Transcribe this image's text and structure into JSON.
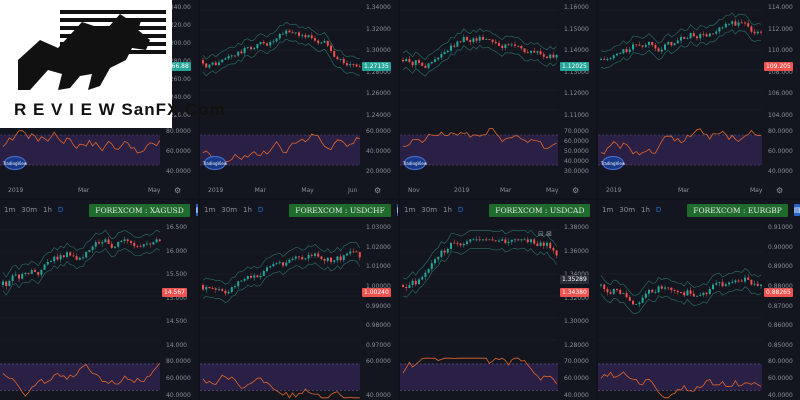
{
  "logo": {
    "text": "R E V I E W SanFX.Com"
  },
  "timeframes": [
    "1m",
    "30m",
    "1h",
    "D"
  ],
  "badge_text": "TradingView",
  "panels": [
    {
      "id": "p1",
      "symbol": "",
      "last": "1366.88",
      "last_color": "#26a69a",
      "yticks": [
        "1340.00",
        "1320.00",
        "1300.00",
        "1280.00",
        "1260.00",
        "1240.00",
        "1220.00"
      ],
      "osc_ticks": [
        "80.0000",
        "60.0000",
        "40.0000"
      ],
      "xlabels": [
        "2019",
        "Mar",
        "May"
      ]
    },
    {
      "id": "p2",
      "symbol": "",
      "last": "1.27135",
      "last_color": "#26a69a",
      "yticks": [
        "1.34000",
        "1.32000",
        "1.30000",
        "1.28000",
        "1.26000",
        "1.24000"
      ],
      "osc_ticks": [
        "60.0000",
        "40.0000",
        "20.0000"
      ],
      "xlabels": [
        "2019",
        "Mar",
        "May",
        "Jun"
      ]
    },
    {
      "id": "p3",
      "symbol": "",
      "last": "1.12025",
      "last_color": "#26a69a",
      "yticks": [
        "1.16000",
        "1.15000",
        "1.14000",
        "1.13000",
        "1.12000",
        "1.11000"
      ],
      "osc_ticks": [
        "70.0000",
        "60.0000",
        "50.0000",
        "40.0000",
        "30.0000"
      ],
      "xlabels": [
        "Nov",
        "2019",
        "Mar",
        "May"
      ]
    },
    {
      "id": "p4",
      "symbol": "",
      "last": "109.205",
      "last_color": "#ef5350",
      "yticks": [
        "114.000",
        "112.000",
        "110.000",
        "108.000",
        "106.000",
        "104.000"
      ],
      "osc_ticks": [
        "80.0000",
        "60.0000",
        "40.0000"
      ],
      "xlabels": [
        "2019",
        "Mar",
        "May"
      ]
    },
    {
      "id": "p5",
      "symbol": "FOREXCOM : XAGUSD",
      "last": "14.567",
      "last_color": "#ef5350",
      "yticks": [
        "16.500",
        "16.000",
        "15.500",
        "15.000",
        "14.500",
        "14.000"
      ],
      "osc_ticks": [
        "80.0000",
        "60.0000",
        "40.0000"
      ],
      "xlabels": []
    },
    {
      "id": "p6",
      "symbol": "FOREXCOM : USDCHF",
      "last": "1.00240",
      "last_color": "#ef5350",
      "yticks": [
        "1.03000",
        "1.02000",
        "1.01000",
        "1.00000",
        "0.99000",
        "0.98000",
        "0.97000"
      ],
      "osc_ticks": [
        "60.0000",
        "40.0000"
      ],
      "xlabels": []
    },
    {
      "id": "p7",
      "symbol": "FOREXCOM : USDCAD",
      "last": "1.34380",
      "last_color": "#ef5350",
      "last2": "1.35289",
      "yticks": [
        "1.38000",
        "1.36000",
        "1.34000",
        "1.32000",
        "1.30000",
        "1.28000"
      ],
      "osc_ticks": [
        "70.0000",
        "60.0000",
        "40.0000"
      ],
      "xlabels": []
    },
    {
      "id": "p8",
      "symbol": "FOREXCOM : EURGBP",
      "last": "0.88265",
      "last_color": "#ef5350",
      "yticks": [
        "0.91000",
        "0.90000",
        "0.89000",
        "0.88000",
        "0.87000",
        "0.86000",
        "0.85000"
      ],
      "osc_ticks": [
        "80.0000",
        "60.0000",
        "40.0000"
      ],
      "xlabels": []
    }
  ]
}
